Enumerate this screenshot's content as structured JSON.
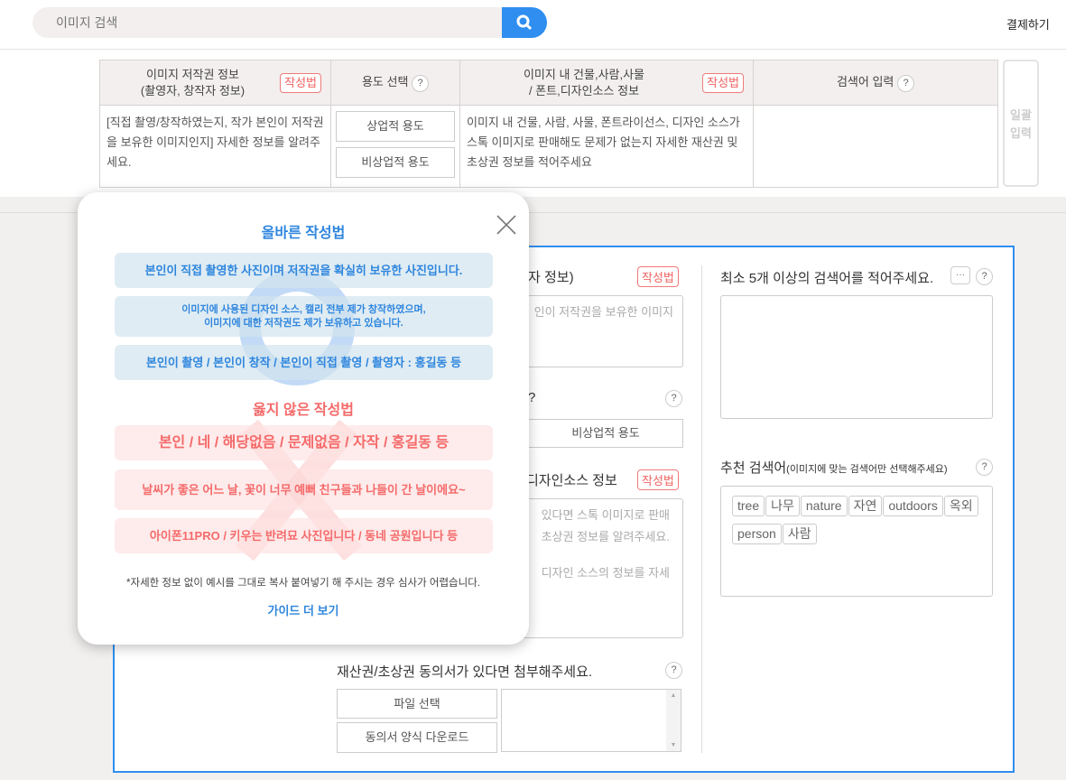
{
  "header": {
    "search_placeholder": "이미지 검색",
    "search_icon": "search-icon",
    "pay_label": "결제하기"
  },
  "table": {
    "headers": [
      {
        "label_line1": "이미지 저작권 정보",
        "label_line2": "(촬영자, 창작자 정보)",
        "badge": "작성법"
      },
      {
        "label": "용도 선택",
        "help": "?"
      },
      {
        "label_line1": "이미지 내 건물,사람,사물",
        "label_line2": "/ 폰트,디자인소스 정보",
        "badge": "작성법"
      },
      {
        "label": "검색어 입력",
        "help": "?"
      }
    ],
    "copyright_hint": "[직접 촬영/창작하였는지, 작가 본인이 저작권을 보유한 이미지인지] 자세한 정보를 알려주세요.",
    "usage_options": [
      "상업적 용도",
      "비상업적 용도"
    ],
    "property_hint": "이미지 내 건물, 사람, 사물, 폰트라이선스, 디자인 소스가 스톡 이미지로 판매해도 문제가 없는지 자세한 재산권 및 초상권 정보를 적어주세요",
    "bulk_button": "일괄 입력"
  },
  "form": {
    "copyright_label": "자 정보)",
    "copyright_badge": "작성법",
    "copyright_placeholder": "인이 저작권을 보유한 이미지",
    "usage_label": "?",
    "usage_help": "?",
    "usage_option_noncommercial": "비상업적 용도",
    "property_label": "디자인소스 정보",
    "property_badge": "작성법",
    "property_placeholder_1": "있다면 스톡 이미지로 판매",
    "property_placeholder_2": "초상권 정보를 알려주세요.",
    "property_placeholder_3": "디자인 소스의 정보를 자세",
    "agreement_label": "재산권/초상권 동의서가 있다면 첨부해주세요.",
    "agreement_help": "?",
    "file_select": "파일 선택",
    "download_form": "동의서 양식 다운로드",
    "keywords_label": "최소 5개 이상의 검색어를 적어주세요.",
    "keywords_more": "···",
    "keywords_help": "?",
    "recommended_label": "추천 검색어",
    "recommended_sub": "(이미지에 맞는 검색어만 선택해주세요)",
    "recommended_help": "?",
    "recommended_tags": [
      "tree",
      "나무",
      "nature",
      "자연",
      "outdoors",
      "옥외",
      "person",
      "사람"
    ]
  },
  "popup": {
    "good_title": "올바른 작성법",
    "good_examples": [
      "본인이 직접 촬영한 사진이며 저작권을 확실히 보유한 사진입니다.",
      "이미지에 사용된 디자인 소스, 캘리 전부 제가 창작하였으며,",
      "이미지에 대한 저작권도 제가 보유하고 있습니다.",
      "본인이 촬영 / 본인이 창작 / 본인이 직접 촬영 / 촬영자 : 홍길동 등"
    ],
    "bad_title": "옳지 않은 작성법",
    "bad_examples": [
      "본인 / 네 / 해당없음 / 문제없음 / 자작 / 홍길동 등",
      "날씨가 좋은 어느 날, 꽃이 너무 예뻐 친구들과 나들이 간 날이에요~",
      "아이폰11PRO / 키우는 반려묘 사진입니다 / 동네 공원입니다 등"
    ],
    "note": "*자세한 정보 없이 예시를 그대로 복사 붙여넣기 해 주시는 경우 심사가 어렵습니다.",
    "guide_link": "가이드 더 보기"
  },
  "colors": {
    "accent": "#2f8ef0",
    "good": "#2f86de",
    "bad": "#f56a6a",
    "badge": "#f06262"
  }
}
